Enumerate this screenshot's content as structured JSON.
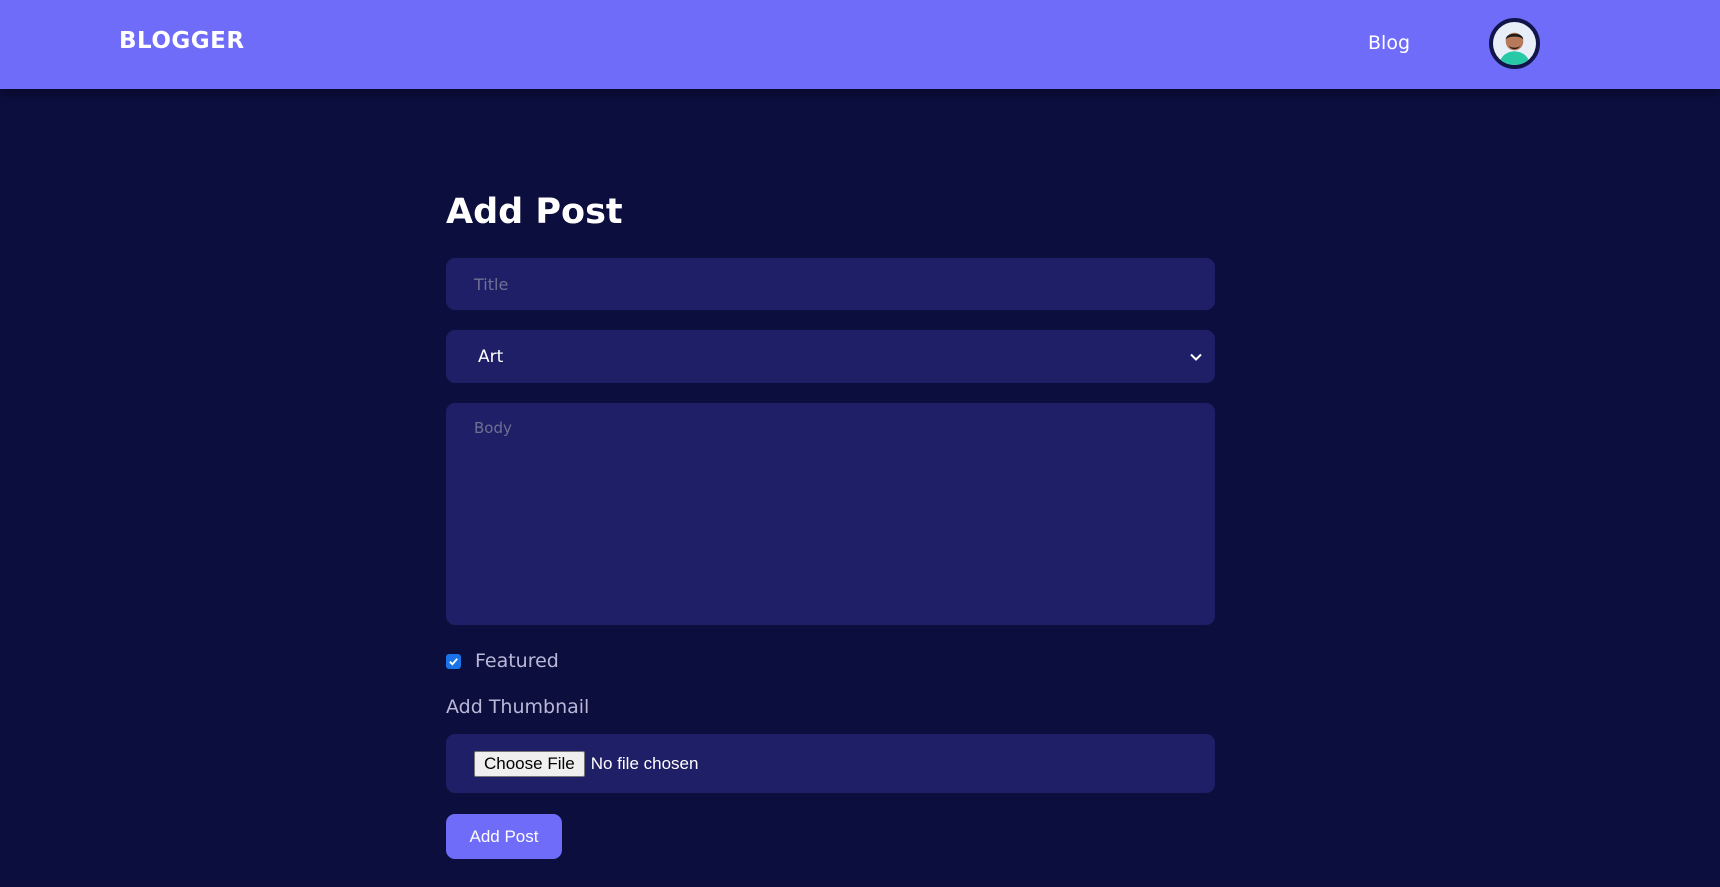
{
  "navbar": {
    "brand": "BLOGGER",
    "links": [
      {
        "label": "Blog"
      }
    ],
    "avatar_icon": "user-avatar-icon"
  },
  "form": {
    "heading": "Add Post",
    "title_placeholder": "Title",
    "category_selected": "Art",
    "body_placeholder": "Body",
    "featured_label": "Featured",
    "featured_checked": true,
    "thumbnail_label": "Add Thumbnail",
    "file_button_label": "Choose File",
    "file_status": "No file chosen",
    "submit_label": "Add Post"
  },
  "colors": {
    "background": "#0c0e3e",
    "navbar": "#6f6cf9",
    "field": "#1e1f66",
    "accent": "#6f6cf9",
    "checkbox": "#1a73e8"
  }
}
